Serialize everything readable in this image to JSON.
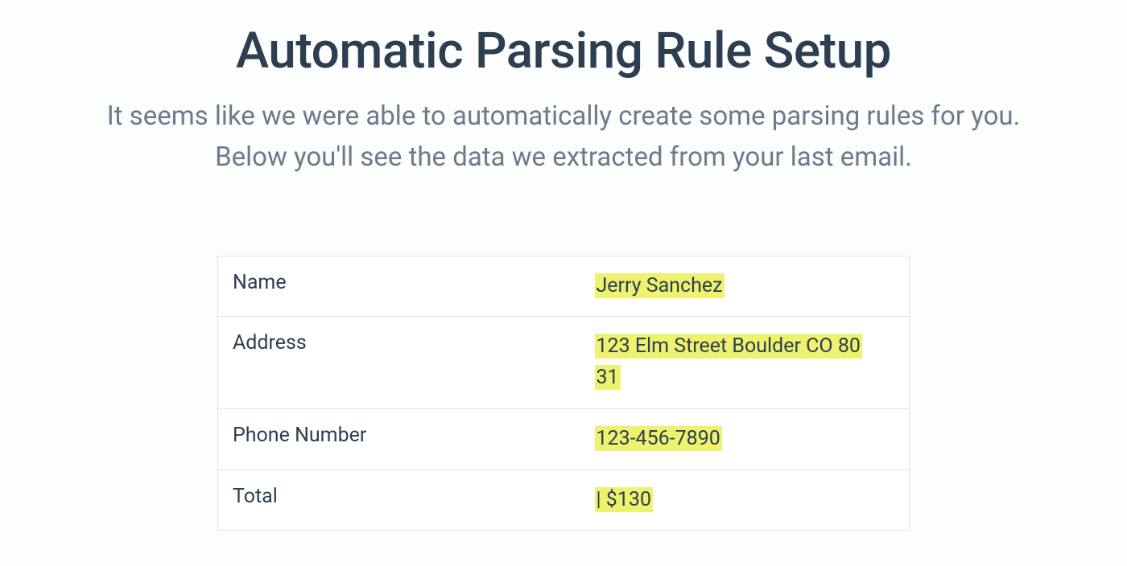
{
  "header": {
    "title": "Automatic Parsing Rule Setup",
    "subtitle": "It seems like we were able to automatically create some parsing rules for you. Below you'll see the data we extracted from your last email."
  },
  "rows": [
    {
      "label": "Name",
      "value": "Jerry Sanchez"
    },
    {
      "label": "Address",
      "value_part1": "123 Elm Street Boulder CO 80",
      "value_part2": "31"
    },
    {
      "label": "Phone Number",
      "value": "123-456-7890"
    },
    {
      "label": "Total",
      "value": "| $130"
    }
  ]
}
